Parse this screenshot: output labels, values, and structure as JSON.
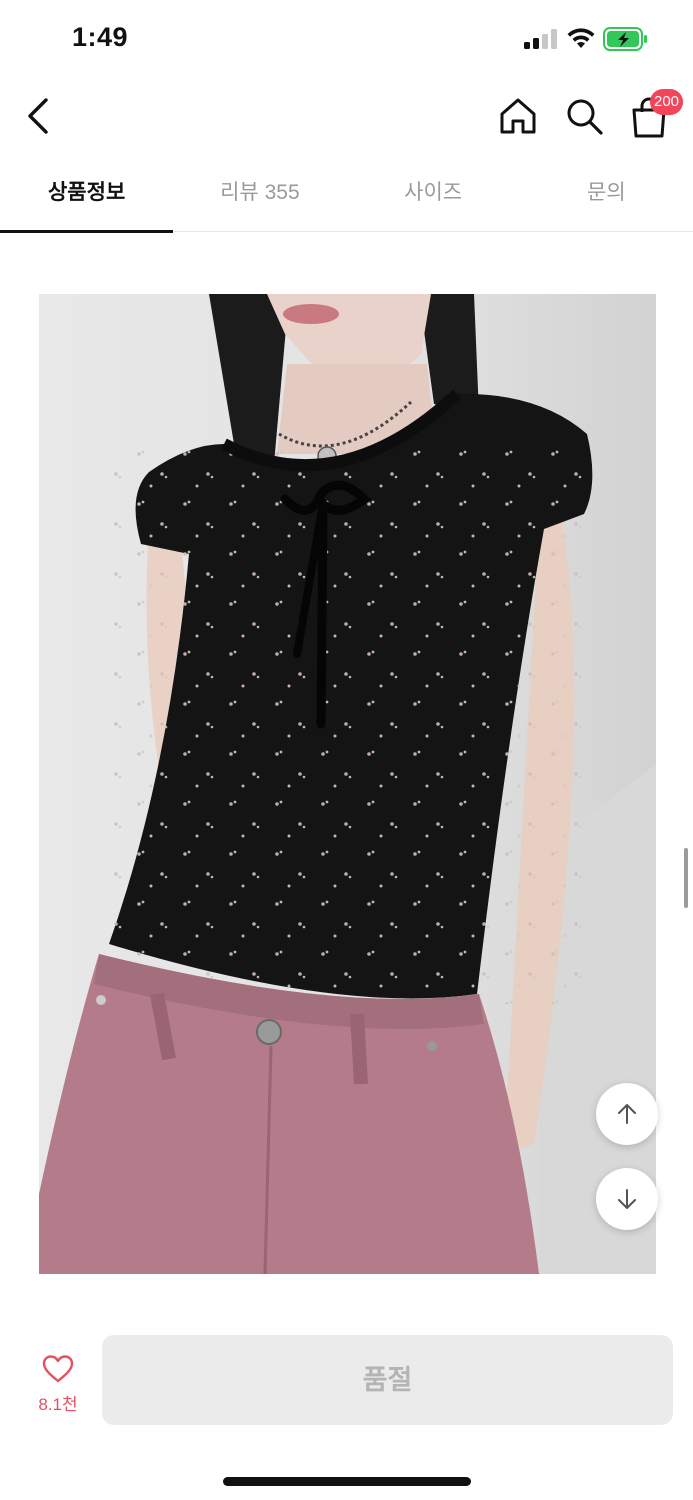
{
  "status_bar": {
    "time": "1:49",
    "icons": [
      "signal-icon",
      "wifi-icon",
      "battery-charging-icon"
    ],
    "battery_color": "#32c759"
  },
  "nav_bar": {
    "icons": [
      "back-chevron-icon",
      "home-icon",
      "search-icon",
      "shopping-bag-icon"
    ],
    "cart_badge": "200",
    "badge_color": "#f2455a"
  },
  "tabs": [
    {
      "label": "상품정보",
      "active": true
    },
    {
      "label": "리뷰 355",
      "active": false
    },
    {
      "label": "사이즈",
      "active": false
    },
    {
      "label": "문의",
      "active": false
    }
  ],
  "product_image": {
    "subject": "model wearing black floral print short-sleeve top with tie neckline and pink pants"
  },
  "float_buttons": {
    "icons": [
      "arrow-up-icon",
      "arrow-down-icon"
    ]
  },
  "bottom_bar": {
    "like_count": "8.1천",
    "like_color": "#e5505f",
    "action_label": "품절"
  }
}
